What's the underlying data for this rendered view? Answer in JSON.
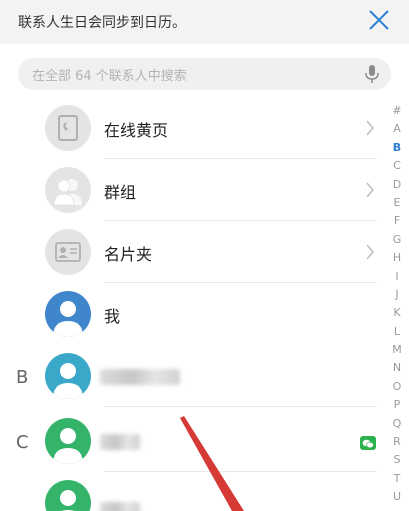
{
  "banner": {
    "text": "联系人生日会同步到日历。"
  },
  "search": {
    "placeholder": "在全部 64 个联系人中搜索"
  },
  "rows": [
    {
      "label": "在线黄页",
      "icon": "phonebook-icon"
    },
    {
      "label": "群组",
      "icon": "group-icon"
    },
    {
      "label": "名片夹",
      "icon": "card-holder-icon"
    },
    {
      "label": "我",
      "icon": "person-avatar-icon"
    }
  ],
  "sections": [
    {
      "letter": "B"
    },
    {
      "letter": "C"
    }
  ],
  "index": [
    "#",
    "A",
    "B",
    "C",
    "D",
    "E",
    "F",
    "G",
    "H",
    "I",
    "J",
    "K",
    "L",
    "M",
    "N",
    "O",
    "P",
    "Q",
    "R",
    "S",
    "T",
    "U"
  ],
  "index_active": "B",
  "colors": {
    "accent": "#2a7fd4",
    "annotation_arrow": "#d63a35",
    "wechat": "#2bb24c"
  }
}
